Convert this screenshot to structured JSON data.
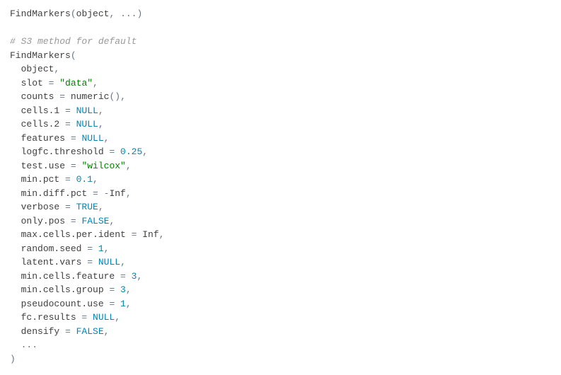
{
  "code": {
    "sig_line": {
      "fn": "FindMarkers",
      "open": "(",
      "arg1": "object",
      "comma": ",",
      "ellipsis": "...",
      "close": ")"
    },
    "comment": "# S3 method for default",
    "def_line": {
      "fn": "FindMarkers",
      "open": "("
    },
    "args": [
      {
        "name": "object"
      },
      {
        "name": "slot",
        "eq": " = ",
        "val": "\"data\"",
        "type": "str"
      },
      {
        "name": "counts",
        "eq": " = ",
        "callFn": "numeric",
        "callOpen": "(",
        "callClose": ")"
      },
      {
        "name": "cells.1",
        "eq": " = ",
        "val": "NULL",
        "type": "kw"
      },
      {
        "name": "cells.2",
        "eq": " = ",
        "val": "NULL",
        "type": "kw"
      },
      {
        "name": "features",
        "eq": " = ",
        "val": "NULL",
        "type": "kw"
      },
      {
        "name": "logfc.threshold",
        "eq": " = ",
        "val": "0.25",
        "type": "num"
      },
      {
        "name": "test.use",
        "eq": " = ",
        "val": "\"wilcox\"",
        "type": "str"
      },
      {
        "name": "min.pct",
        "eq": " = ",
        "val": "0.1",
        "type": "num"
      },
      {
        "name": "min.diff.pct",
        "eq": " = ",
        "prefix": "-",
        "val": "Inf",
        "type": "const"
      },
      {
        "name": "verbose",
        "eq": " = ",
        "val": "TRUE",
        "type": "kw"
      },
      {
        "name": "only.pos",
        "eq": " = ",
        "val": "FALSE",
        "type": "kw"
      },
      {
        "name": "max.cells.per.ident",
        "eq": " = ",
        "val": "Inf",
        "type": "const"
      },
      {
        "name": "random.seed",
        "eq": " = ",
        "val": "1",
        "type": "num"
      },
      {
        "name": "latent.vars",
        "eq": " = ",
        "val": "NULL",
        "type": "kw"
      },
      {
        "name": "min.cells.feature",
        "eq": " = ",
        "val": "3",
        "type": "num"
      },
      {
        "name": "min.cells.group",
        "eq": " = ",
        "val": "3",
        "type": "num"
      },
      {
        "name": "pseudocount.use",
        "eq": " = ",
        "val": "1",
        "type": "num"
      },
      {
        "name": "fc.results",
        "eq": " = ",
        "val": "NULL",
        "type": "kw"
      },
      {
        "name": "densify",
        "eq": " = ",
        "val": "FALSE",
        "type": "kw"
      },
      {
        "ellipsis": "..."
      }
    ],
    "close": ")"
  }
}
